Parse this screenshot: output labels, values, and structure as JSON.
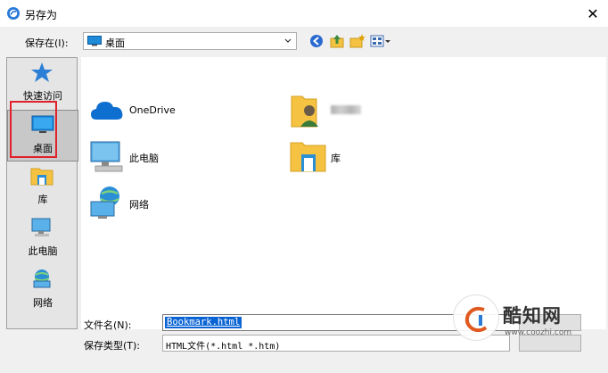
{
  "window": {
    "title": "另存为",
    "close_glyph": "✕"
  },
  "location": {
    "label": "保存在(I):",
    "value": "桌面"
  },
  "places": [
    {
      "label": "快速访问",
      "icon": "star-icon",
      "selected": false
    },
    {
      "label": "桌面",
      "icon": "desktop-icon",
      "selected": true
    },
    {
      "label": "库",
      "icon": "library-folder-icon",
      "selected": false
    },
    {
      "label": "此电脑",
      "icon": "computer-icon",
      "selected": false
    },
    {
      "label": "网络",
      "icon": "network-icon",
      "selected": false
    }
  ],
  "files": [
    {
      "label": "OneDrive",
      "icon": "onedrive-cloud-icon"
    },
    {
      "label": "",
      "icon": "user-folder-icon",
      "blurred": true
    },
    {
      "label": "此电脑",
      "icon": "computer-icon"
    },
    {
      "label": "库",
      "icon": "library-folder-icon"
    },
    {
      "label": "网络",
      "icon": "network-icon"
    }
  ],
  "filename": {
    "label": "文件名(N):",
    "value": "Bookmark.html"
  },
  "filetype": {
    "label": "保存类型(T):",
    "value": "HTML文件(*.html *.htm)"
  },
  "watermark": {
    "title": "酷知网",
    "url": "www.coozhi.com"
  },
  "colors": {
    "accent": "#0a64d4",
    "highlight_frame": "#e0202a",
    "folder": "#f5c242",
    "panel": "#f0f0f0"
  }
}
